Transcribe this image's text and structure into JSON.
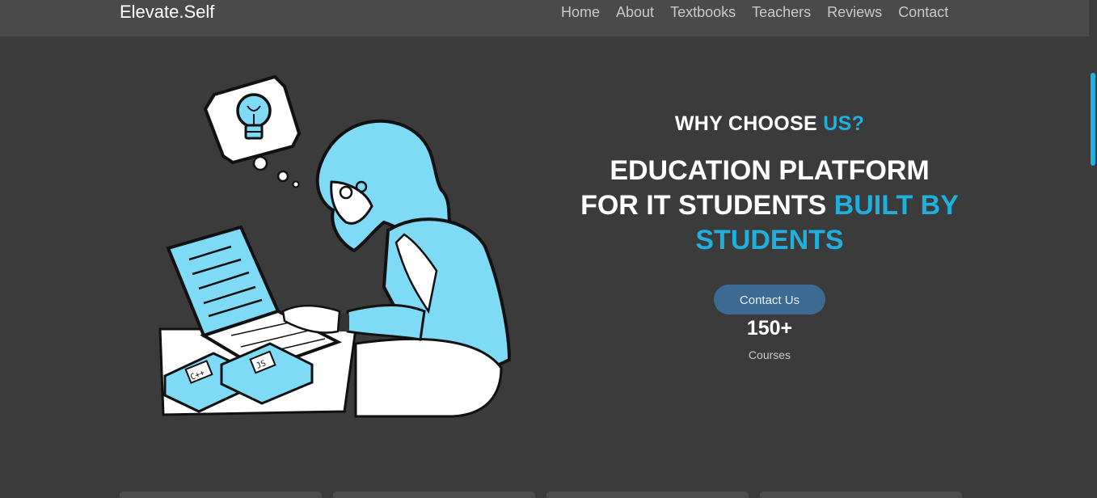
{
  "nav": {
    "brand": "Elevate.Self",
    "links": [
      "Home",
      "About",
      "Textbooks",
      "Teachers",
      "Reviews",
      "Contact"
    ]
  },
  "hero": {
    "eyebrow_prefix": "WHY CHOOSE ",
    "eyebrow_accent": "US?",
    "headline_line1": "EDUCATION PLATFORM",
    "headline_line2_white": "FOR IT STUDENTS ",
    "headline_line2_accent": "BUILT BY",
    "headline_line3_accent": "STUDENTS",
    "cta_label": "Contact Us",
    "stat_value": "150+",
    "stat_label": "Courses"
  },
  "illustration": {
    "book1_label": "C++",
    "book2_label": "JS"
  },
  "colors": {
    "accent": "#1fb0de",
    "background": "#3b3b3b",
    "navbar": "#4a4a4a",
    "button": "#3d6a92",
    "illustration_fill": "#7fdaf5"
  }
}
